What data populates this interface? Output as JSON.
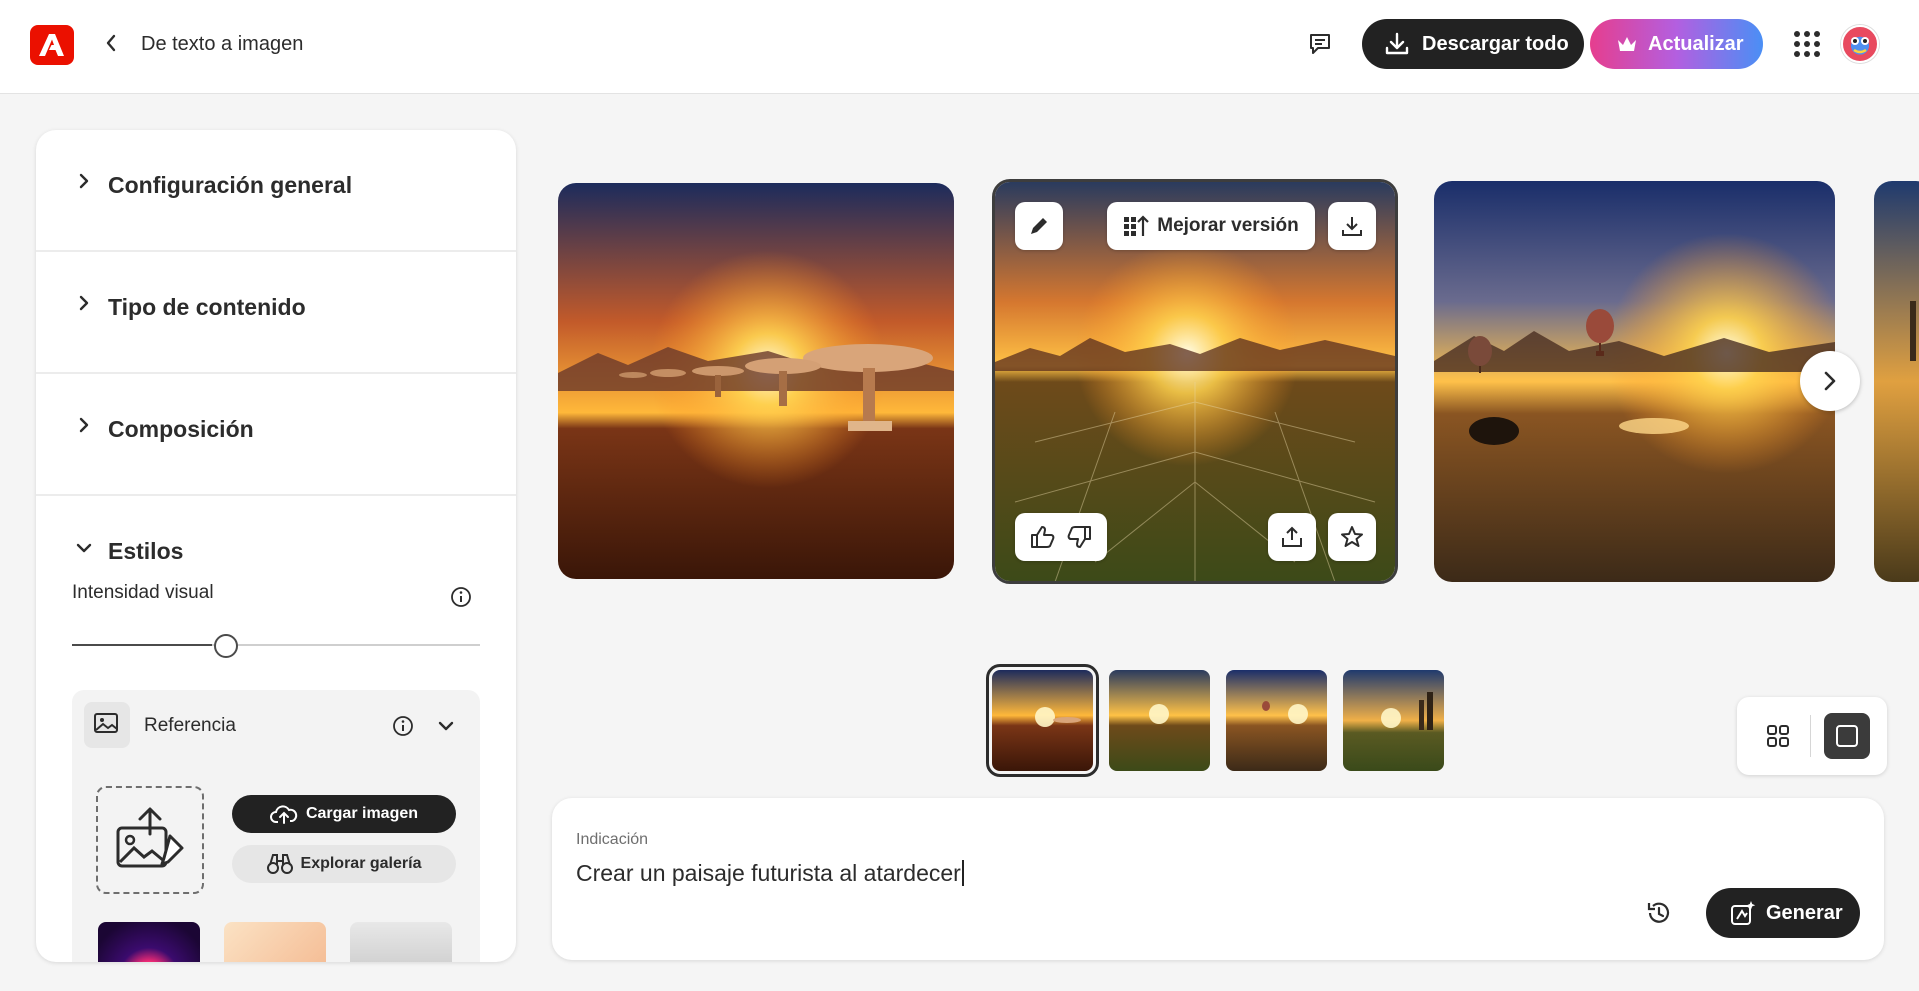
{
  "header": {
    "title": "De texto a imagen",
    "download_all_label": "Descargar todo",
    "upgrade_label": "Actualizar"
  },
  "left_panel": {
    "sections": [
      {
        "label": "Configuración general",
        "expanded": false
      },
      {
        "label": "Tipo de contenido",
        "expanded": false
      },
      {
        "label": "Composición",
        "expanded": false
      },
      {
        "label": "Estilos",
        "expanded": true
      }
    ],
    "visual_intensity_label": "Intensidad visual",
    "visual_intensity_value": 0.38,
    "reference": {
      "label": "Referencia",
      "upload_label": "Cargar imagen",
      "explore_label": "Explorar galería"
    }
  },
  "gallery": {
    "selected_index": 1,
    "hover_actions": {
      "edit_icon": "pencil-icon",
      "enhance_label": "Mejorar versión",
      "download_icon": "download-icon",
      "like_icon": "thumbs-up-icon",
      "dislike_icon": "thumbs-down-icon",
      "share_icon": "share-icon",
      "favorite_icon": "star-icon"
    },
    "thumbnails_count": 4,
    "selected_thumbnail": 0
  },
  "prompt": {
    "label": "Indicación",
    "value": "Crear un paisaje futurista al atardecer",
    "generate_label": "Generar"
  },
  "colors": {
    "brand_red": "#eb1000",
    "dark_button": "#222222",
    "upgrade_gradient_start": "#e63e8e",
    "upgrade_gradient_end": "#4a8ff5"
  }
}
